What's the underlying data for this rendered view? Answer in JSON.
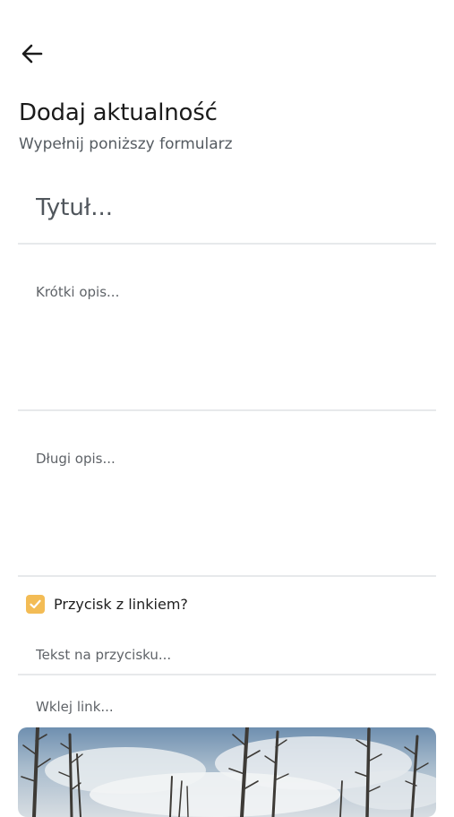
{
  "header": {
    "back_icon": "arrow-left-icon",
    "title": "Dodaj aktualność",
    "subtitle": "Wypełnij poniższy formularz"
  },
  "form": {
    "title_field": {
      "value": "",
      "placeholder": "Tytuł..."
    },
    "short_description": {
      "value": "",
      "placeholder": "Krótki opis..."
    },
    "long_description": {
      "value": "",
      "placeholder": "Długi opis..."
    },
    "link_button_checkbox": {
      "label": "Przycisk z linkiem?",
      "checked": true,
      "icon": "checkmark-icon"
    },
    "button_text_field": {
      "value": "",
      "placeholder": "Tekst na przycisku..."
    },
    "link_field": {
      "value": "",
      "placeholder": "Wklej link..."
    },
    "image_preview": {
      "subject": "bare-trees-cloudy-sky"
    }
  },
  "colors": {
    "accent": "#f3bc55",
    "divider": "#e7e9eb",
    "subtitle": "#555b61"
  }
}
